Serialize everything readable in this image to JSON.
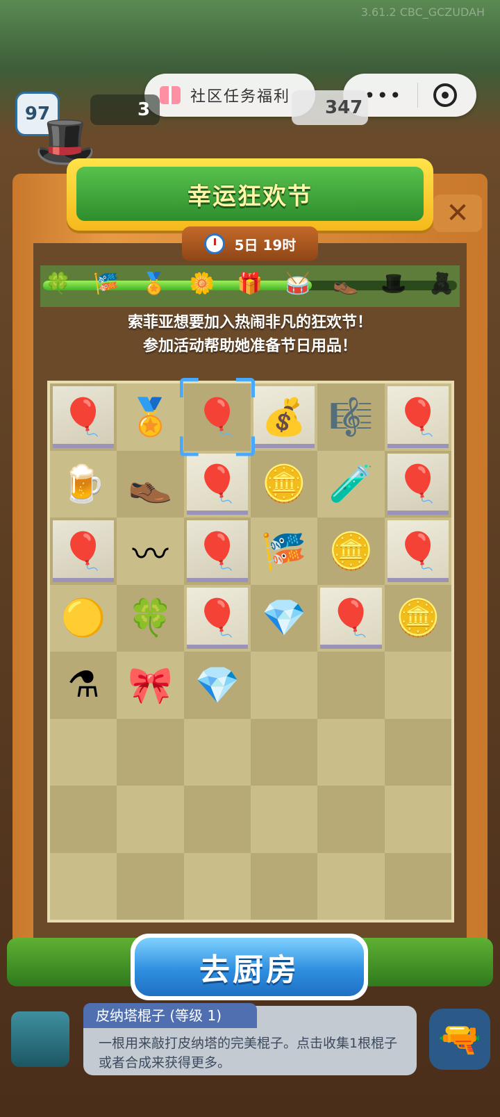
{
  "status": {
    "version_text": "3.61.2 CBC_GCZUDAH"
  },
  "hud": {
    "level": "97",
    "energy": "3",
    "gems": "347"
  },
  "mini_program": {
    "title": "社区任务福利"
  },
  "event": {
    "title": "幸运狂欢节",
    "timer": "5日 19时",
    "description_line1": "索菲亚想要加入热闹非凡的狂欢节！",
    "description_line2": "参加活动帮助她准备节日用品！",
    "progress": 0.65,
    "milestones": [
      {
        "icon": "🍀",
        "locked": false
      },
      {
        "icon": "🎏",
        "locked": false
      },
      {
        "icon": "🏅",
        "locked": false
      },
      {
        "icon": "🌼",
        "locked": false
      },
      {
        "icon": "🎁",
        "locked": false
      },
      {
        "icon": "🥁",
        "locked": false
      },
      {
        "icon": "👞",
        "locked": false
      },
      {
        "icon": "🎩",
        "locked": true
      },
      {
        "icon": "🧸",
        "locked": true
      }
    ]
  },
  "grid": {
    "rows": [
      [
        {
          "icon": "🎈",
          "boxed": true
        },
        {
          "icon": "🏅",
          "boxed": false
        },
        {
          "icon": "🎈",
          "boxed": false,
          "selected": true
        },
        {
          "icon": "💰",
          "boxed": true
        },
        {
          "icon": "🎼",
          "boxed": false
        },
        {
          "icon": "🎈",
          "boxed": true
        }
      ],
      [
        {
          "icon": "🍺",
          "boxed": false
        },
        {
          "icon": "👞",
          "boxed": false
        },
        {
          "icon": "🎈",
          "boxed": true
        },
        {
          "icon": "🪙",
          "boxed": false
        },
        {
          "icon": "🧪",
          "boxed": false
        },
        {
          "icon": "🎈",
          "boxed": true
        }
      ],
      [
        {
          "icon": "🎈",
          "boxed": true
        },
        {
          "icon": "〰",
          "boxed": false
        },
        {
          "icon": "🎈",
          "boxed": true
        },
        {
          "icon": "🎏",
          "boxed": false
        },
        {
          "icon": "🪙",
          "boxed": false
        },
        {
          "icon": "🎈",
          "boxed": true
        }
      ],
      [
        {
          "icon": "🟡",
          "boxed": false
        },
        {
          "icon": "🍀",
          "boxed": false
        },
        {
          "icon": "🎈",
          "boxed": true
        },
        {
          "icon": "💎",
          "boxed": false
        },
        {
          "icon": "🎈",
          "boxed": true
        },
        {
          "icon": "🪙",
          "boxed": false
        }
      ],
      [
        {
          "icon": "⚗",
          "boxed": false
        },
        {
          "icon": "🎀",
          "boxed": false
        },
        {
          "icon": "💎",
          "boxed": false
        },
        {
          "icon": "",
          "boxed": false
        },
        {
          "icon": "",
          "boxed": false
        },
        {
          "icon": "",
          "boxed": false
        }
      ],
      [
        {
          "icon": "",
          "boxed": false
        },
        {
          "icon": "",
          "boxed": false
        },
        {
          "icon": "",
          "boxed": false
        },
        {
          "icon": "",
          "boxed": false
        },
        {
          "icon": "",
          "boxed": false
        },
        {
          "icon": "",
          "boxed": false
        }
      ],
      [
        {
          "icon": "",
          "boxed": false
        },
        {
          "icon": "",
          "boxed": false
        },
        {
          "icon": "",
          "boxed": false
        },
        {
          "icon": "",
          "boxed": false
        },
        {
          "icon": "",
          "boxed": false
        },
        {
          "icon": "",
          "boxed": false
        }
      ],
      [
        {
          "icon": "",
          "boxed": false
        },
        {
          "icon": "",
          "boxed": false
        },
        {
          "icon": "",
          "boxed": false
        },
        {
          "icon": "",
          "boxed": false
        },
        {
          "icon": "",
          "boxed": false
        },
        {
          "icon": "",
          "boxed": false
        }
      ]
    ]
  },
  "actions": {
    "go_kitchen": "去厨房"
  },
  "item_info": {
    "title": "皮纳塔棍子 (等级 1)",
    "description": "一根用来敲打皮纳塔的完美棍子。点击收集1根棍子或者合成来获得更多。"
  }
}
